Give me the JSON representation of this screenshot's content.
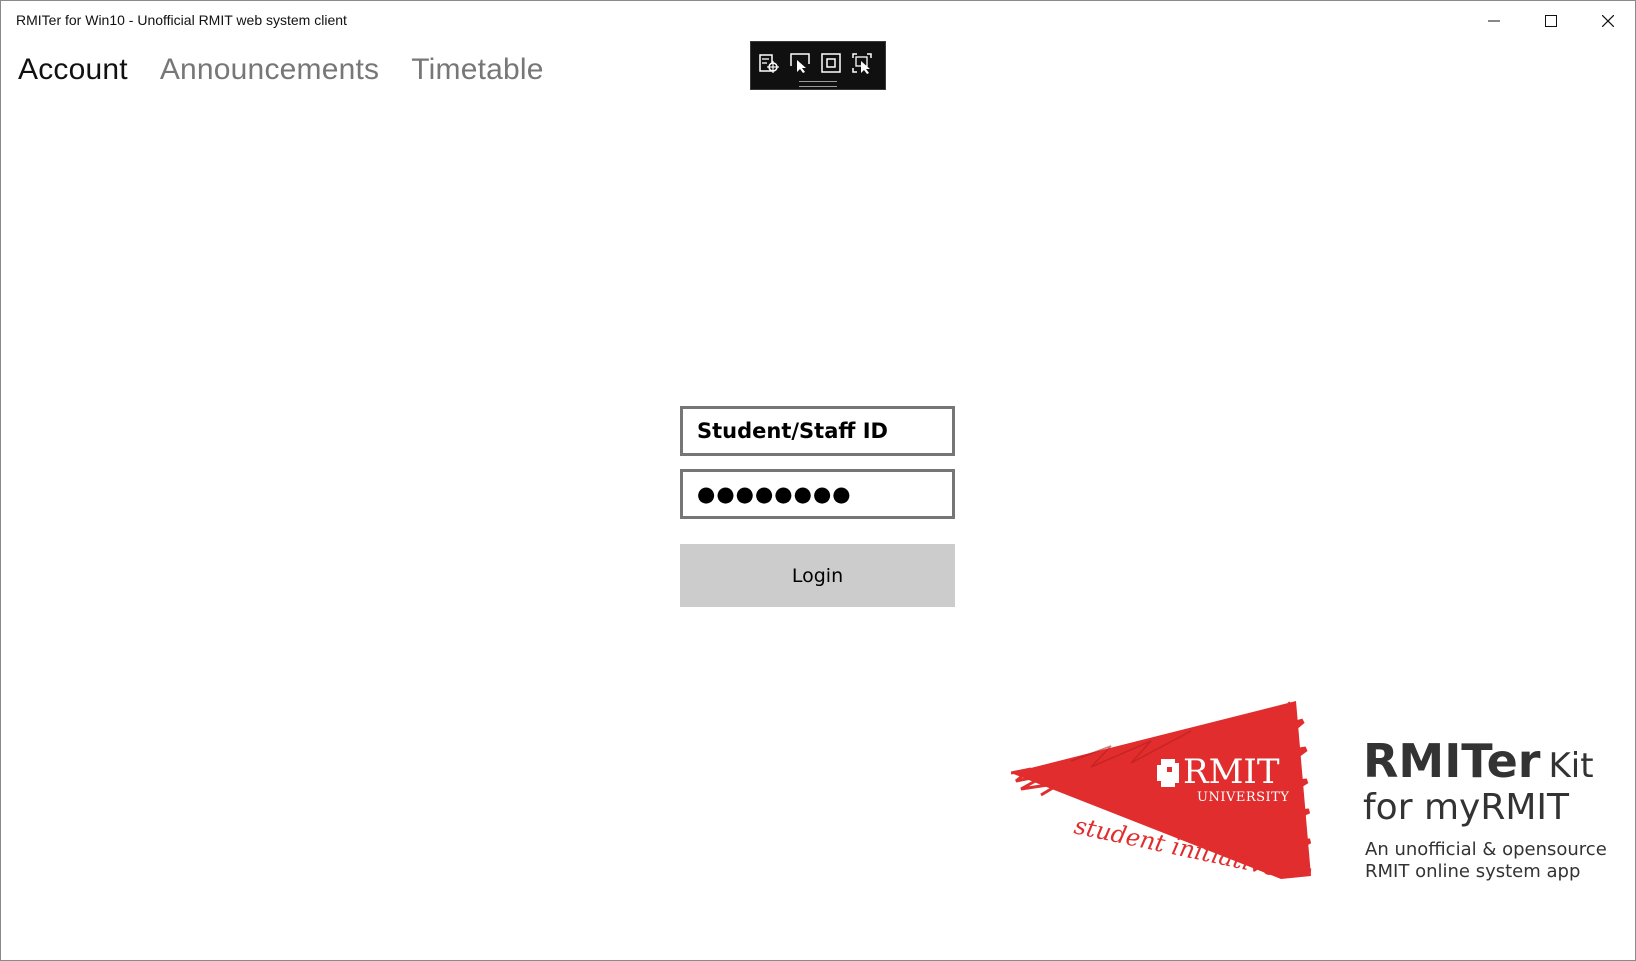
{
  "window": {
    "title": "RMITer for Win10 - Unofficial RMIT web system client"
  },
  "nav": {
    "tabs": [
      {
        "label": "Account",
        "active": true
      },
      {
        "label": "Announcements",
        "active": false
      },
      {
        "label": "Timetable",
        "active": false
      }
    ]
  },
  "devtools_toolbar": {
    "icons": [
      "live-visual-tree-icon",
      "select-element-icon",
      "display-layout-adorners-icon",
      "track-focus-icon"
    ]
  },
  "login": {
    "id_field_value": "Student/Staff ID",
    "password_field_value": "●●●●●●●●",
    "login_label": "Login"
  },
  "branding": {
    "logo_word": "RMIT",
    "logo_sub": "UNIVERSITY",
    "logo_tagline": "student initiative",
    "name": "RMITer",
    "kit": "Kit",
    "subtitle": "for myRMIT",
    "description_line1": "An unofficial & opensource",
    "description_line2": "RMIT online system app",
    "accent_color": "#e12d2d"
  }
}
